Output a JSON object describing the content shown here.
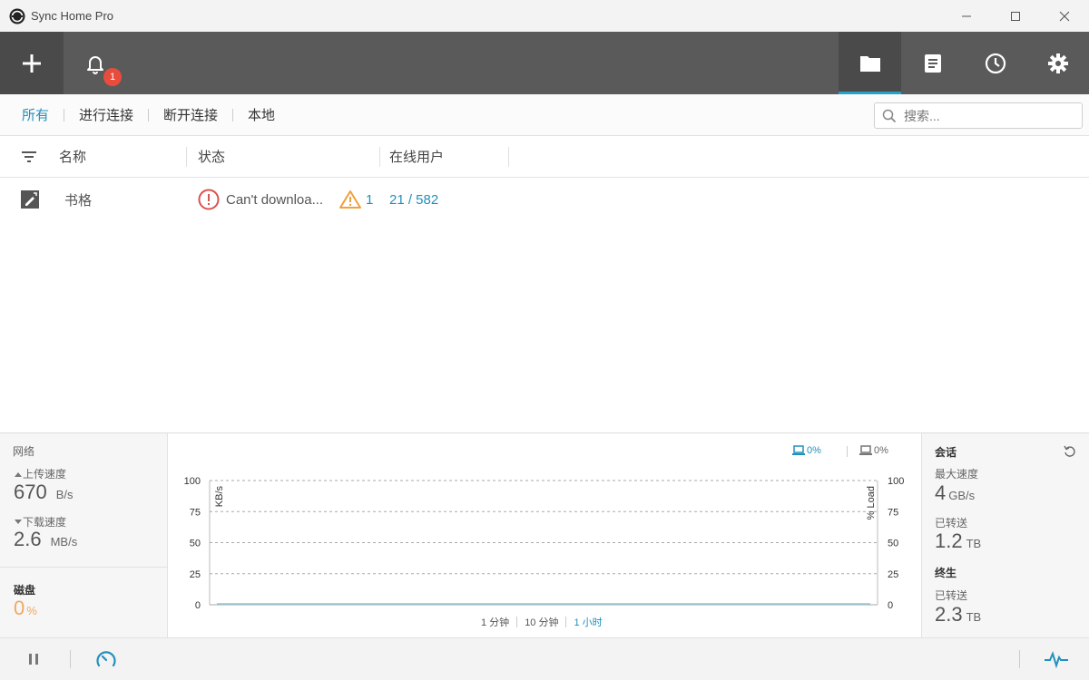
{
  "window": {
    "title": "Sync Home Pro"
  },
  "toolbar": {
    "notification_count": "1"
  },
  "filter_tabs": [
    "所有",
    "进行连接",
    "断开连接",
    "本地"
  ],
  "search": {
    "placeholder": "搜索..."
  },
  "columns": {
    "name": "名称",
    "status": "状态",
    "online_users": "在线用户"
  },
  "rows": [
    {
      "name": "书格",
      "status": "Can't downloa...",
      "warnings": "1",
      "online_users": "21 / 582"
    }
  ],
  "network": {
    "title": "网络",
    "upload_label": "上传速度",
    "upload_value": "670",
    "upload_unit": "B/s",
    "download_label": "下载速度",
    "download_value": "2.6",
    "download_unit": "MB/s"
  },
  "disk": {
    "title": "磁盘",
    "value": "0",
    "unit": "%"
  },
  "chart_legend": {
    "cpu_a": "0%",
    "cpu_b": "0%"
  },
  "chart_data": {
    "type": "line",
    "ylabel": "KB/s",
    "y2label": "% Load",
    "ylim": [
      0,
      100
    ],
    "yticks": [
      "100",
      "75",
      "50",
      "25",
      "0"
    ],
    "series": [
      {
        "values": [
          0,
          0
        ]
      }
    ],
    "grid": true
  },
  "time_ranges": [
    "1 分钟",
    "10 分钟",
    "1 小时"
  ],
  "time_range_active": "1 小时",
  "session": {
    "title": "会话",
    "max_speed_label": "最大速度",
    "max_speed_value": "4",
    "max_speed_unit": "GB/s",
    "transferred_label": "已转送",
    "transferred_value": "1.2",
    "transferred_unit": "TB"
  },
  "lifetime": {
    "title": "终生",
    "transferred_label": "已转送",
    "transferred_value": "2.3",
    "transferred_unit": "TB"
  },
  "colors": {
    "accent": "#2190bd",
    "toolbar": "#5a5a5a",
    "error": "#d9534f",
    "warning": "#f0a03c",
    "disk": "#f0a862"
  }
}
